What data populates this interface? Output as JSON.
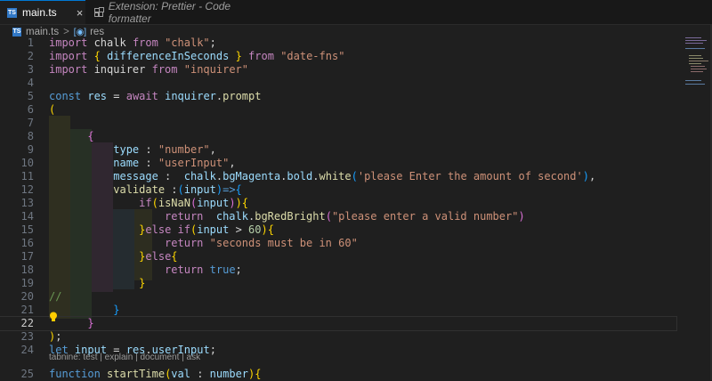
{
  "tabs": [
    {
      "label": "main.ts",
      "icon": "TS",
      "active": true,
      "close": "×"
    },
    {
      "label": "Extension: Prettier - Code formatter",
      "icon": "extension-icon",
      "active": false
    }
  ],
  "breadcrumb": {
    "file": "main.ts",
    "separator": ">",
    "symbol": "res"
  },
  "lines": [
    {
      "n": "1",
      "tokens": [
        [
          "kwc",
          "import"
        ],
        [
          "plain",
          " chalk "
        ],
        [
          "kwc",
          "from"
        ],
        [
          "plain",
          " "
        ],
        [
          "str",
          "\"chalk\""
        ],
        [
          "plain",
          ";"
        ]
      ]
    },
    {
      "n": "2",
      "tokens": [
        [
          "kwc",
          "import"
        ],
        [
          "plain",
          " "
        ],
        [
          "br1",
          "{"
        ],
        [
          "plain",
          " "
        ],
        [
          "var",
          "differenceInSeconds"
        ],
        [
          "plain",
          " "
        ],
        [
          "br1",
          "}"
        ],
        [
          "plain",
          " "
        ],
        [
          "kwc",
          "from"
        ],
        [
          "plain",
          " "
        ],
        [
          "str",
          "\"date-fns\""
        ]
      ]
    },
    {
      "n": "3",
      "tokens": [
        [
          "kwc",
          "import"
        ],
        [
          "plain",
          " inquirer "
        ],
        [
          "kwc",
          "from"
        ],
        [
          "plain",
          " "
        ],
        [
          "str",
          "\"inquirer\""
        ]
      ]
    },
    {
      "n": "4",
      "tokens": []
    },
    {
      "n": "5",
      "tokens": [
        [
          "kw",
          "const"
        ],
        [
          "plain",
          " "
        ],
        [
          "var",
          "res"
        ],
        [
          "plain",
          " = "
        ],
        [
          "kwc",
          "await"
        ],
        [
          "plain",
          " "
        ],
        [
          "var",
          "inquirer"
        ],
        [
          "plain",
          "."
        ],
        [
          "fn",
          "prompt"
        ]
      ]
    },
    {
      "n": "6",
      "tokens": [
        [
          "br1",
          "("
        ]
      ]
    },
    {
      "n": "7",
      "tokens": []
    },
    {
      "n": "8",
      "tokens": [
        [
          "plain",
          "      "
        ],
        [
          "br2",
          "{"
        ]
      ]
    },
    {
      "n": "9",
      "tokens": [
        [
          "plain",
          "          "
        ],
        [
          "var",
          "type"
        ],
        [
          "plain",
          " : "
        ],
        [
          "str",
          "\"number\""
        ],
        [
          "plain",
          ","
        ]
      ]
    },
    {
      "n": "10",
      "tokens": [
        [
          "plain",
          "          "
        ],
        [
          "var",
          "name"
        ],
        [
          "plain",
          " : "
        ],
        [
          "str",
          "\"userInput\""
        ],
        [
          "plain",
          ","
        ]
      ]
    },
    {
      "n": "11",
      "tokens": [
        [
          "plain",
          "          "
        ],
        [
          "var",
          "message"
        ],
        [
          "plain",
          " :  "
        ],
        [
          "var",
          "chalk"
        ],
        [
          "plain",
          "."
        ],
        [
          "var",
          "bgMagenta"
        ],
        [
          "plain",
          "."
        ],
        [
          "var",
          "bold"
        ],
        [
          "plain",
          "."
        ],
        [
          "fn",
          "white"
        ],
        [
          "br3",
          "("
        ],
        [
          "str",
          "'please Enter the amount of second'"
        ],
        [
          "br3",
          ")"
        ],
        [
          "plain",
          ","
        ]
      ]
    },
    {
      "n": "12",
      "tokens": [
        [
          "plain",
          "          "
        ],
        [
          "fn",
          "validate"
        ],
        [
          "plain",
          " :"
        ],
        [
          "br3",
          "("
        ],
        [
          "var",
          "input"
        ],
        [
          "br3",
          ")"
        ],
        [
          "kw",
          "=>"
        ],
        [
          "br3",
          "{"
        ]
      ]
    },
    {
      "n": "13",
      "tokens": [
        [
          "plain",
          "              "
        ],
        [
          "kwc",
          "if"
        ],
        [
          "br1",
          "("
        ],
        [
          "fn",
          "isNaN"
        ],
        [
          "br2",
          "("
        ],
        [
          "var",
          "input"
        ],
        [
          "br2",
          ")"
        ],
        [
          "br1",
          ")"
        ],
        [
          "br1",
          "{"
        ]
      ]
    },
    {
      "n": "14",
      "tokens": [
        [
          "plain",
          "                  "
        ],
        [
          "kwc",
          "return"
        ],
        [
          "plain",
          "  "
        ],
        [
          "var",
          "chalk"
        ],
        [
          "plain",
          "."
        ],
        [
          "fn",
          "bgRedBright"
        ],
        [
          "br2",
          "("
        ],
        [
          "str",
          "\"please enter a valid number\""
        ],
        [
          "br2",
          ")"
        ]
      ]
    },
    {
      "n": "15",
      "tokens": [
        [
          "plain",
          "              "
        ],
        [
          "br1",
          "}"
        ],
        [
          "kwc",
          "else"
        ],
        [
          "plain",
          " "
        ],
        [
          "kwc",
          "if"
        ],
        [
          "br1",
          "("
        ],
        [
          "var",
          "input"
        ],
        [
          "plain",
          " > "
        ],
        [
          "num",
          "60"
        ],
        [
          "br1",
          ")"
        ],
        [
          "br1",
          "{"
        ]
      ]
    },
    {
      "n": "16",
      "tokens": [
        [
          "plain",
          "                  "
        ],
        [
          "kwc",
          "return"
        ],
        [
          "plain",
          " "
        ],
        [
          "str",
          "\"seconds must be in 60\""
        ]
      ]
    },
    {
      "n": "17",
      "tokens": [
        [
          "plain",
          "              "
        ],
        [
          "br1",
          "}"
        ],
        [
          "kwc",
          "else"
        ],
        [
          "br1",
          "{"
        ]
      ]
    },
    {
      "n": "18",
      "tokens": [
        [
          "plain",
          "                  "
        ],
        [
          "kwc",
          "return"
        ],
        [
          "plain",
          " "
        ],
        [
          "kw",
          "true"
        ],
        [
          "plain",
          ";"
        ]
      ]
    },
    {
      "n": "19",
      "tokens": [
        [
          "plain",
          "              "
        ],
        [
          "br1",
          "}"
        ]
      ]
    },
    {
      "n": "20",
      "tokens": [
        [
          "cmt",
          "//"
        ]
      ]
    },
    {
      "n": "21",
      "tokens": [
        [
          "plain",
          "          "
        ],
        [
          "br3",
          "}"
        ]
      ]
    },
    {
      "n": "22",
      "tokens": [
        [
          "plain",
          "      "
        ],
        [
          "br2",
          "}"
        ]
      ]
    },
    {
      "n": "23",
      "tokens": [
        [
          "br1",
          ")"
        ],
        [
          "plain",
          ";"
        ]
      ]
    },
    {
      "n": "24",
      "tokens": [
        [
          "kw",
          "let"
        ],
        [
          "plain",
          " "
        ],
        [
          "var",
          "input"
        ],
        [
          "plain",
          " = "
        ],
        [
          "var",
          "res"
        ],
        [
          "plain",
          "."
        ],
        [
          "var",
          "userInput"
        ],
        [
          "plain",
          ";"
        ]
      ]
    },
    {
      "n": "25",
      "tokens": [
        [
          "kw",
          "function"
        ],
        [
          "plain",
          " "
        ],
        [
          "fn",
          "startTime"
        ],
        [
          "br1",
          "("
        ],
        [
          "var",
          "val"
        ],
        [
          "plain",
          " : "
        ],
        [
          "var",
          "number"
        ],
        [
          "br1",
          ")"
        ],
        [
          "br1",
          "{"
        ]
      ]
    }
  ],
  "current_line": "22",
  "codelens": "tabnine: test | explain | document | ask"
}
